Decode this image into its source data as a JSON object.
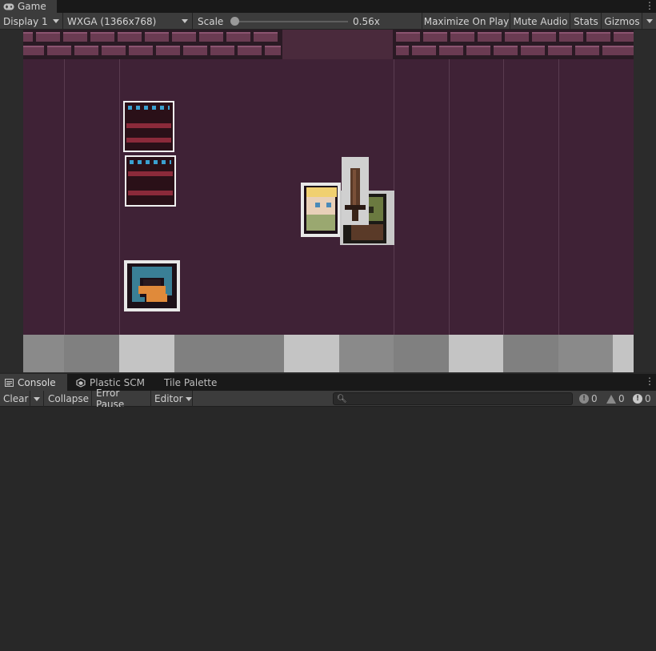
{
  "game_tab": {
    "title": "Game",
    "icon": "gamepad-icon"
  },
  "toolbar": {
    "display": "Display 1",
    "resolution": "WXGA (1366x768)",
    "scale_label": "Scale",
    "scale_value": "0.56x",
    "scale_slider_position": 0.02,
    "maximize_on_play": "Maximize On Play",
    "mute_audio": "Mute Audio",
    "stats": "Stats",
    "gizmos": "Gizmos"
  },
  "console_tabs": [
    {
      "label": "Console",
      "icon": "console-icon",
      "active": true
    },
    {
      "label": "Plastic SCM",
      "icon": "plastic-scm-icon",
      "active": false
    },
    {
      "label": "Tile Palette",
      "icon": "",
      "active": false
    }
  ],
  "console_toolbar": {
    "clear": "Clear",
    "collapse": "Collapse",
    "error_pause": "Error Pause",
    "editor": "Editor",
    "search_placeholder": "",
    "search_icon": "search-icon",
    "log_count": "0",
    "warning_count": "0",
    "error_count": "0"
  },
  "colors": {
    "scene_floor": "#3f2236",
    "wall": "#6a3b52",
    "editor_bg": "#282828",
    "toolbar_bg": "#3c3c3c"
  }
}
